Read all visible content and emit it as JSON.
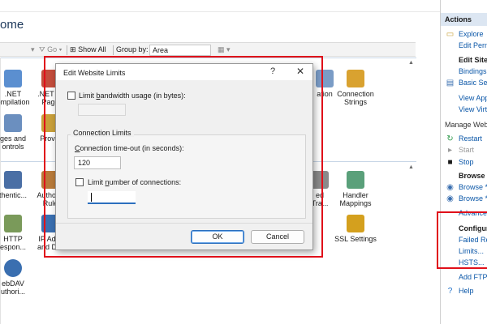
{
  "page": {
    "title": "ome"
  },
  "filter_bar": {
    "go_label": "Go",
    "show_all_label": "Show All",
    "group_by_label": "Group by:",
    "group_by_value": "Area"
  },
  "features": [
    {
      "label": ".NET\nompilation",
      "icon": "compilation-icon",
      "color": "#5b8fd0"
    },
    {
      "label": ".NET Er\nPage",
      "icon": "error-pages-icon",
      "color": "#c44d3c"
    },
    {
      "label": "ation",
      "icon": "feature-icon",
      "color": "#7a9cc6"
    },
    {
      "label": "Connection\nStrings",
      "icon": "database-icon",
      "color": "#d9a230"
    },
    {
      "label": "ges and\nontrols",
      "icon": "pages-controls-icon",
      "color": "#6b8fbf"
    },
    {
      "label": "Provid",
      "icon": "providers-icon",
      "color": "#c9a03a"
    },
    {
      "label": "thentic...",
      "icon": "authentication-icon",
      "color": "#4a6fa5"
    },
    {
      "label": "Authoriz\nRule",
      "icon": "authorization-icon",
      "color": "#b87a3a"
    },
    {
      "label": "ed\nTra...",
      "icon": "failed-request-icon",
      "color": "#8a8a8a"
    },
    {
      "label": "Handler\nMappings",
      "icon": "handler-mappings-icon",
      "color": "#5aa07a"
    },
    {
      "label": "HTTP\nespon...",
      "icon": "http-response-icon",
      "color": "#7a9a5a"
    },
    {
      "label": "IP Addr\nand Dor",
      "icon": "ip-address-icon",
      "color": "#3a6fb0"
    },
    {
      "label": "SSL Settings",
      "icon": "ssl-lock-icon",
      "color": "#d4a01e"
    },
    {
      "label": "ebDAV\nuthori...",
      "icon": "webdav-icon",
      "color": "#3a6fb0"
    }
  ],
  "dialog": {
    "title": "Edit Website Limits",
    "help": "?",
    "close": "✕",
    "limit_bandwidth_label": "Limit bandwidth usage (in bytes):",
    "limit_bandwidth_pre": "Limit ",
    "limit_bandwidth_u": "b",
    "limit_bandwidth_post": "andwidth usage (in bytes):",
    "limit_bandwidth_checked": false,
    "connection_limits_label": "Connection Limits",
    "timeout_pre": "",
    "timeout_u": "C",
    "timeout_post": "onnection time-out (in seconds):",
    "timeout_value": "120",
    "limit_connections_pre": "Limit ",
    "limit_connections_u": "n",
    "limit_connections_post": "umber of connections:",
    "limit_connections_checked": false,
    "connections_value": "",
    "ok_label": "OK",
    "cancel_label": "Cancel"
  },
  "actions_pane": {
    "header": "Actions",
    "explore": "Explore",
    "edit_perm": "Edit Perm",
    "edit_site_header": "Edit Site",
    "bindings": "Bindings...",
    "basic_settings": "Basic Setti",
    "view_app": "View App",
    "view_virt": "View Virtu",
    "manage_header": "Manage Webs",
    "restart": "Restart",
    "start": "Start",
    "stop": "Stop",
    "browse_header": "Browse W",
    "browse_1": "Browse *:",
    "browse_2": "Browse *:",
    "advanced": "Advance",
    "configure_header": "Configure",
    "failed_req": "Failed Req",
    "limits": "Limits...",
    "hsts": "HSTS...",
    "add_ftp": "Add FTP P",
    "help": "Help"
  },
  "colors": {
    "highlight": "#e0101a",
    "link": "#0b57a8",
    "accent": "#2c6fbe"
  }
}
